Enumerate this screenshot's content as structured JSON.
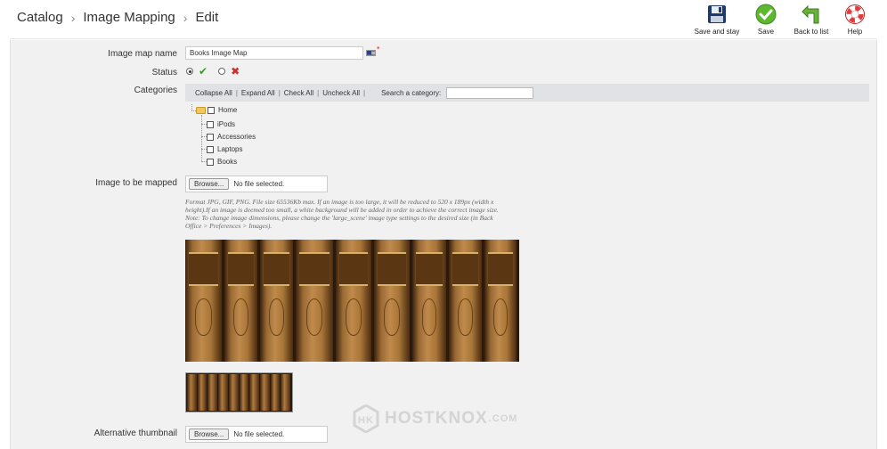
{
  "breadcrumb": {
    "items": [
      "Catalog",
      "Image Mapping",
      "Edit"
    ]
  },
  "toolbar": {
    "save_and_stay": "Save and stay",
    "save": "Save",
    "back": "Back to list",
    "help": "Help"
  },
  "form": {
    "name_label": "Image map name",
    "name_value": "Books Image Map",
    "required_mark": "*",
    "status_label": "Status",
    "categories_label": "Categories",
    "image_label": "Image to be mapped",
    "alt_label": "Alternative thumbnail"
  },
  "categories": {
    "collapse": "Collapse All",
    "expand": "Expand All",
    "check": "Check All",
    "uncheck": "Uncheck All",
    "search_label": "Search a category:",
    "root": "Home",
    "children": [
      "iPods",
      "Accessories",
      "Laptops",
      "Books"
    ]
  },
  "file": {
    "browse": "Browse...",
    "status": "No file selected."
  },
  "hint": {
    "line1": "Format JPG, GIF, PNG. File size 65536Kb max. If an image is too large, it will be reduced to 520 x 189px (width x height).If an image is deemed too small, a white background will be added in order to achieve the correct image size.",
    "line2": "Note: To change image dimensions, please change the 'large_scene' image type settings to the desired size (in Back Office > Preferences > Images)."
  },
  "watermark": {
    "brand": "HOSTKNOX",
    "suffix": ".COM"
  },
  "colors": {
    "accent_green": "#3b9a1e",
    "status_red": "#d42a2a",
    "panel_bg": "#f1f1f1"
  }
}
